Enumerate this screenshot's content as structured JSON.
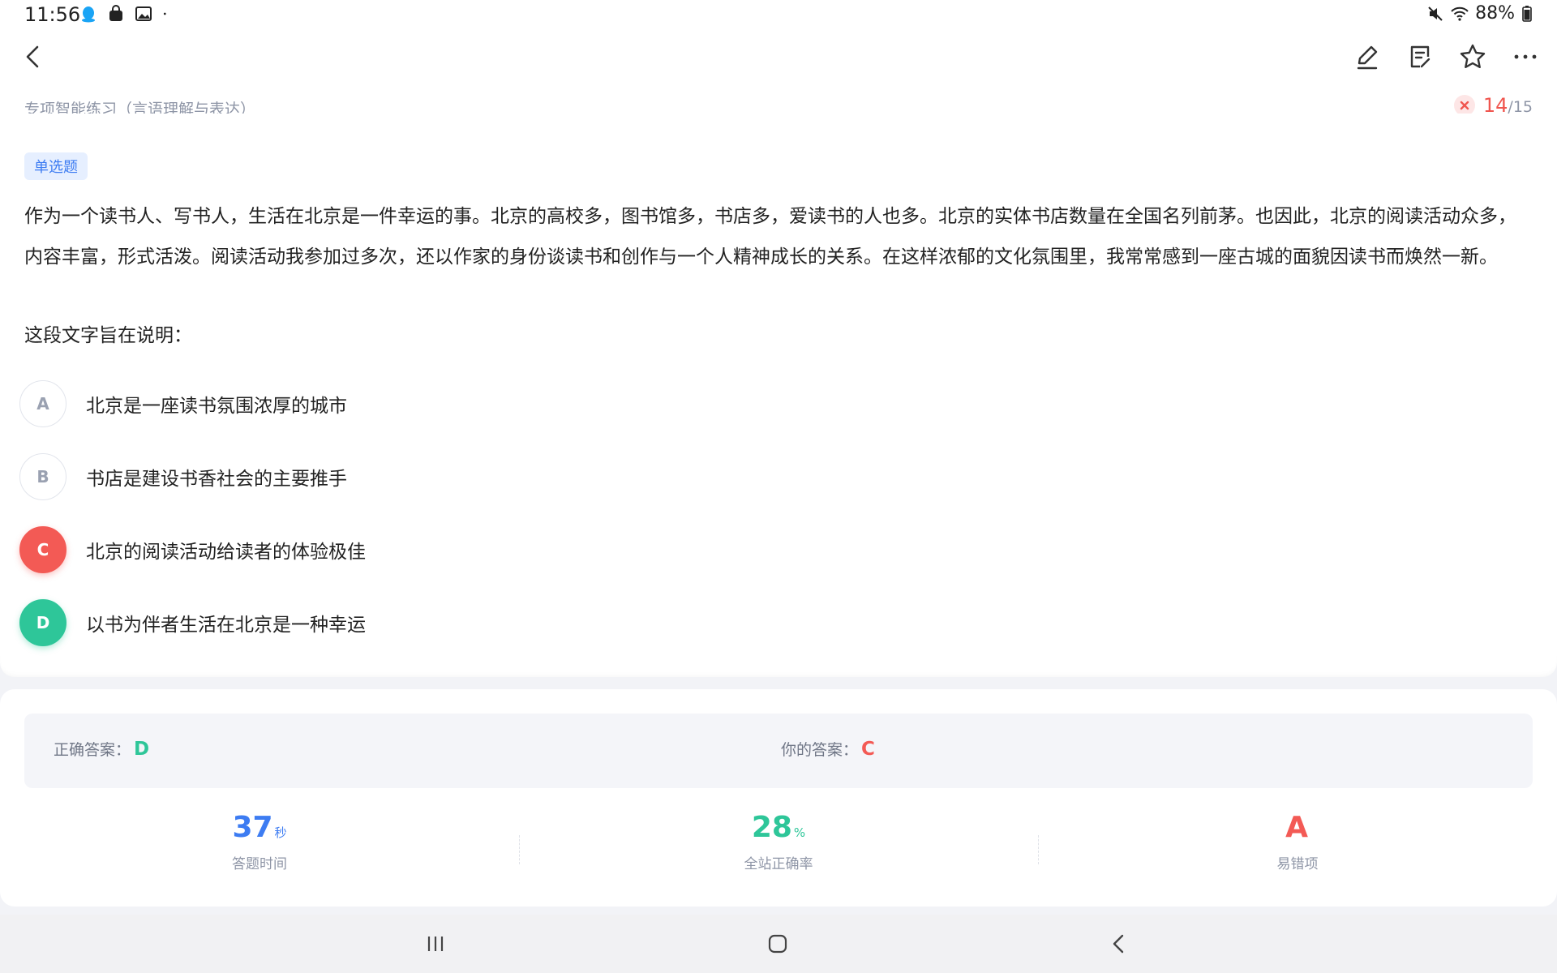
{
  "status_bar": {
    "time": "11:56",
    "battery": "88%",
    "left_icons": [
      "qq-icon",
      "bag-icon",
      "image-icon",
      "dot-icon"
    ],
    "right_icons": [
      "mute-icon",
      "wifi-icon",
      "battery-icon"
    ]
  },
  "toolbar": {
    "breadcrumb": "专项智能练习（言语理解与表达）",
    "progress_current": "14",
    "progress_total": "/15",
    "icons": [
      "back-icon",
      "edit-icon",
      "note-icon",
      "star-icon",
      "more-icon"
    ]
  },
  "question": {
    "type_badge": "单选题",
    "text": "作为一个读书人、写书人，生活在北京是一件幸运的事。北京的高校多，图书馆多，书店多，爱读书的人也多。北京的实体书店数量在全国名列前茅。也因此，北京的阅读活动众多，内容丰富，形式活泼。阅读活动我参加过多次，还以作家的身份谈读书和创作与一个人精神成长的关系。在这样浓郁的文化氛围里，我常常感到一座古城的面貌因读书而焕然一新。",
    "prompt": "这段文字旨在说明：",
    "options": [
      {
        "letter": "A",
        "text": "北京是一座读书氛围浓厚的城市"
      },
      {
        "letter": "B",
        "text": "书店是建设书香社会的主要推手"
      },
      {
        "letter": "C",
        "text": "北京的阅读活动给读者的体验极佳"
      },
      {
        "letter": "D",
        "text": "以书为伴者生活在北京是一种幸运"
      }
    ]
  },
  "answer": {
    "correct_label": "正确答案：",
    "correct_value": "D",
    "yours_label": "你的答案：",
    "yours_value": "C"
  },
  "stats": [
    {
      "value": "37",
      "unit": "秒",
      "label": "答题时间"
    },
    {
      "value": "28",
      "unit": "%",
      "label": "全站正确率"
    },
    {
      "value": "A",
      "unit": "",
      "label": "易错项"
    }
  ],
  "colors": {
    "wrong": "#f35a55",
    "correct": "#2ec699",
    "accent_blue": "#3d7cf2"
  }
}
